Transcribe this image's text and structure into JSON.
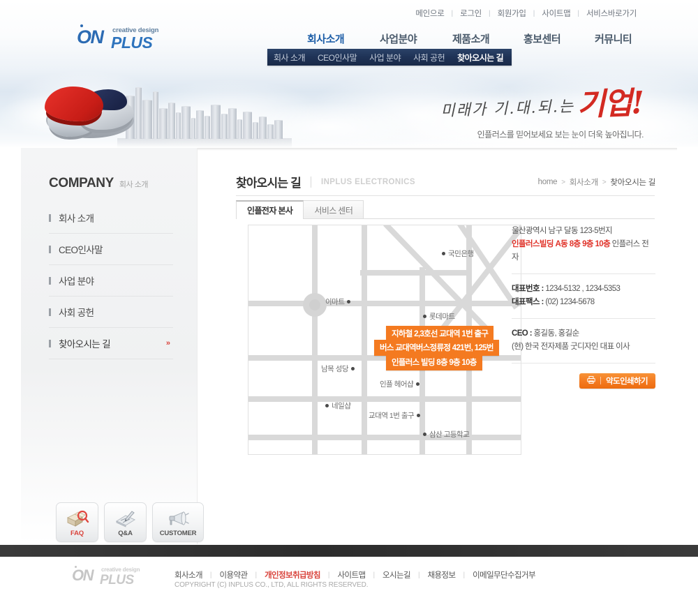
{
  "brand": {
    "logo_on": "ON",
    "logo_plus": "PLUS",
    "logo_tagline": "creative design"
  },
  "utility_nav": [
    {
      "label": "메인으로"
    },
    {
      "label": "로그인"
    },
    {
      "label": "회원가입"
    },
    {
      "label": "사이트맵"
    },
    {
      "label": "서비스바로가기"
    }
  ],
  "main_nav": [
    {
      "label": "회사소개",
      "active": true
    },
    {
      "label": "사업분야",
      "active": false
    },
    {
      "label": "제품소개",
      "active": false
    },
    {
      "label": "홍보센터",
      "active": false
    },
    {
      "label": "커뮤니티",
      "active": false
    }
  ],
  "sub_nav": [
    {
      "label": "회사 소개",
      "active": false
    },
    {
      "label": "CEO인사말",
      "active": false
    },
    {
      "label": "사업 분야",
      "active": false
    },
    {
      "label": "사회 공헌",
      "active": false
    },
    {
      "label": "찾아오시는 길",
      "active": true
    }
  ],
  "hero": {
    "calligraphy": "미래가 기.대.되.는",
    "calligraphy_accent": "기업!",
    "subtitle": "인플러스를 믿어보세요 보는 눈이 더욱 높아집니다."
  },
  "sidebar": {
    "heading_en": "COMPANY",
    "heading_ko": "회사 소개",
    "items": [
      {
        "label": "회사 소개",
        "active": false
      },
      {
        "label": "CEO인사말",
        "active": false
      },
      {
        "label": "사업 분야",
        "active": false
      },
      {
        "label": "사회 공헌",
        "active": false
      },
      {
        "label": "찾아오시는 길",
        "active": true,
        "arrow": "»"
      }
    ],
    "quick_buttons": [
      {
        "label": "FAQ",
        "icon": "box-magnifier-icon"
      },
      {
        "label": "Q&A",
        "icon": "pencil-note-icon"
      },
      {
        "label": "CUSTOMER",
        "icon": "megaphone-icon"
      }
    ]
  },
  "content": {
    "title": "찾아오시는 길",
    "subtitle": "INPLUS ELECTRONICS",
    "breadcrumb": [
      "home",
      "회사소개",
      "찾아오시는 길"
    ],
    "tabs": [
      {
        "label": "인플전자 본사",
        "active": true
      },
      {
        "label": "서비스 센터",
        "active": false
      }
    ],
    "map": {
      "pois": [
        {
          "label": "국민은행"
        },
        {
          "label": "이마트"
        },
        {
          "label": "롯데마트"
        },
        {
          "label": "남목 성당"
        },
        {
          "label": "인플 헤어샵"
        },
        {
          "label": "네일샵"
        },
        {
          "label": "교대역 1번 출구"
        },
        {
          "label": "삼산 고등학교"
        }
      ],
      "callouts": [
        {
          "label": "지하철 2,3호선 교대역 1번 출구"
        },
        {
          "label": "버스 교대역버스정류정 421번, 125번"
        },
        {
          "label": "인플러스 빌딩 8층 9층 10층"
        }
      ]
    },
    "info": {
      "address_line1": "울산광역시 남구 달동 123-5번지",
      "address_building": "인플러스빌딩  A동 8층 9층 10층",
      "address_company": " 인플러스 전자",
      "tel_label": "대표번호 :",
      "tel_value": " 1234-5132 , 1234-5353",
      "fax_label": "대표팩스 :",
      "fax_value": " (02) 1234-5678",
      "ceo_label": "CEO :",
      "ceo_value": " 홍길동, 홍길순",
      "ceo_title": "(현) 한국 전자제품 굿디자인 대표 이사",
      "print_button": "약도인쇄하기"
    }
  },
  "footer": {
    "links": [
      {
        "label": "회사소개",
        "highlight": false
      },
      {
        "label": "이용약관",
        "highlight": false
      },
      {
        "label": "개인정보취급방침",
        "highlight": true
      },
      {
        "label": "사이트맵",
        "highlight": false
      },
      {
        "label": "오시는길",
        "highlight": false
      },
      {
        "label": "채용정보",
        "highlight": false
      },
      {
        "label": "이메일무단수집거부",
        "highlight": false
      }
    ],
    "copyright": "COPYRIGHT (C) INPLUS CO., LTD, ALL RIGHTS RESERVED."
  },
  "colors": {
    "accent_blue": "#1f5fa8",
    "subnav_navy": "#1e3154",
    "accent_orange": "#f47a20",
    "accent_red": "#d9443c"
  }
}
